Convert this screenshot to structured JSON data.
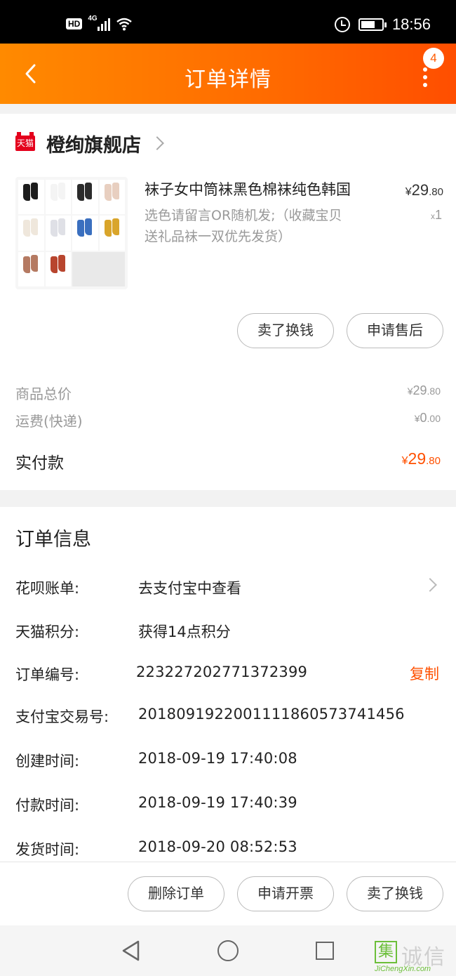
{
  "status_bar": {
    "hd": "HD",
    "network": "4G",
    "time": "18:56"
  },
  "header": {
    "title": "订单详情",
    "badge_count": "4"
  },
  "shop": {
    "brand_tag": "天猫",
    "name": "橙绚旗舰店"
  },
  "product": {
    "title": "袜子女中筒袜黑色棉袜纯色韩国",
    "price_symbol": "¥",
    "price_int": "29",
    "price_dec": ".80",
    "sku_line1": "选色请留言OR随机发;（收藏宝贝",
    "sku_line2": "送礼品袜一双优先发货）",
    "qty_prefix": "x",
    "qty": "1",
    "thumb_colors": [
      "#1c1c1c",
      "#f4f4f4",
      "#2b2b2b",
      "#e8cfc0",
      "#efe7dc",
      "#dfe0e6",
      "#3a6fbf",
      "#d9a52b",
      "#b57a62",
      "#b8452e"
    ]
  },
  "item_buttons": {
    "sell": "卖了换钱",
    "after_sale": "申请售后"
  },
  "summary": {
    "goods_label": "商品总价",
    "goods_int": "29",
    "goods_dec": ".80",
    "shipping_label": "运费(快递)",
    "shipping_int": "0",
    "shipping_dec": ".00",
    "paid_label": "实付款",
    "paid_int": "29",
    "paid_dec": ".80",
    "currency": "¥"
  },
  "order_info": {
    "title": "订单信息",
    "rows": [
      {
        "label": "花呗账单:",
        "value": "去支付宝中查看"
      },
      {
        "label": "天猫积分:",
        "value": "获得14点积分"
      },
      {
        "label": "订单编号:",
        "value": "223227202771372399",
        "action": "复制"
      },
      {
        "label": "支付宝交易号:",
        "value": "2018091922001111860573741456"
      },
      {
        "label": "创建时间:",
        "value": "2018-09-19 17:40:08"
      },
      {
        "label": "付款时间:",
        "value": "2018-09-19 17:40:39"
      },
      {
        "label": "发货时间:",
        "value": "2018-09-20 08:52:53"
      }
    ]
  },
  "bottom_actions": {
    "delete": "删除订单",
    "invoice": "申请开票",
    "sell": "卖了换钱"
  },
  "watermark": {
    "mark": "集",
    "cn": "诚信",
    "en": "JiChengXin.com"
  },
  "colors": {
    "accent": "#ff5000",
    "header_start": "#ff8a00",
    "header_end": "#ff4e00",
    "tmall_red": "#e4001c"
  }
}
